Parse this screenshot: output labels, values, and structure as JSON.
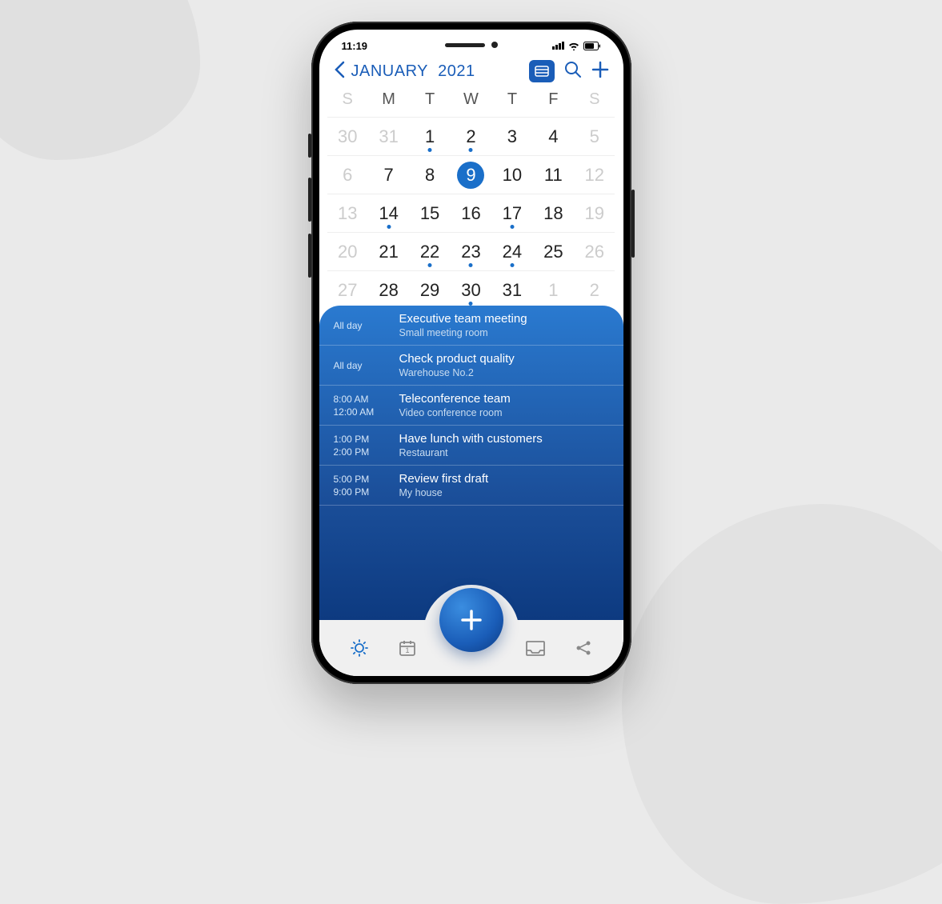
{
  "status": {
    "time": "11:19"
  },
  "header": {
    "month": "JANUARY",
    "year": "2021"
  },
  "weekdays": [
    "S",
    "M",
    "T",
    "W",
    "T",
    "F",
    "S"
  ],
  "calendar": [
    {
      "n": "30",
      "dim": true
    },
    {
      "n": "31",
      "dim": true
    },
    {
      "n": "1",
      "dot": true
    },
    {
      "n": "2",
      "dot": true
    },
    {
      "n": "3"
    },
    {
      "n": "4"
    },
    {
      "n": "5",
      "dim": true
    },
    {
      "n": "6",
      "dim": true
    },
    {
      "n": "7"
    },
    {
      "n": "8"
    },
    {
      "n": "9",
      "selected": true
    },
    {
      "n": "10"
    },
    {
      "n": "11"
    },
    {
      "n": "12",
      "dim": true
    },
    {
      "n": "13",
      "dim": true
    },
    {
      "n": "14",
      "dot": true
    },
    {
      "n": "15"
    },
    {
      "n": "16"
    },
    {
      "n": "17",
      "dot": true
    },
    {
      "n": "18"
    },
    {
      "n": "19",
      "dim": true
    },
    {
      "n": "20",
      "dim": true
    },
    {
      "n": "21"
    },
    {
      "n": "22",
      "dot": true
    },
    {
      "n": "23",
      "dot": true
    },
    {
      "n": "24",
      "dot": true
    },
    {
      "n": "25"
    },
    {
      "n": "26",
      "dim": true
    },
    {
      "n": "27",
      "dim": true
    },
    {
      "n": "28"
    },
    {
      "n": "29"
    },
    {
      "n": "30",
      "dot": true
    },
    {
      "n": "31"
    },
    {
      "n": "1",
      "dim": true
    },
    {
      "n": "2",
      "dim": true
    }
  ],
  "events": [
    {
      "time1": "All day",
      "time2": "",
      "title": "Executive team meeting",
      "sub": "Small meeting room"
    },
    {
      "time1": "All day",
      "time2": "",
      "title": "Check product quality",
      "sub": "Warehouse  No.2"
    },
    {
      "time1": "8:00 AM",
      "time2": "12:00 AM",
      "title": "Teleconference team",
      "sub": "Video conference room"
    },
    {
      "time1": "1:00 PM",
      "time2": "2:00 PM",
      "title": "Have lunch with customers",
      "sub": "Restaurant"
    },
    {
      "time1": "5:00 PM",
      "time2": "9:00 PM",
      "title": "Review first draft",
      "sub": "My house"
    }
  ]
}
